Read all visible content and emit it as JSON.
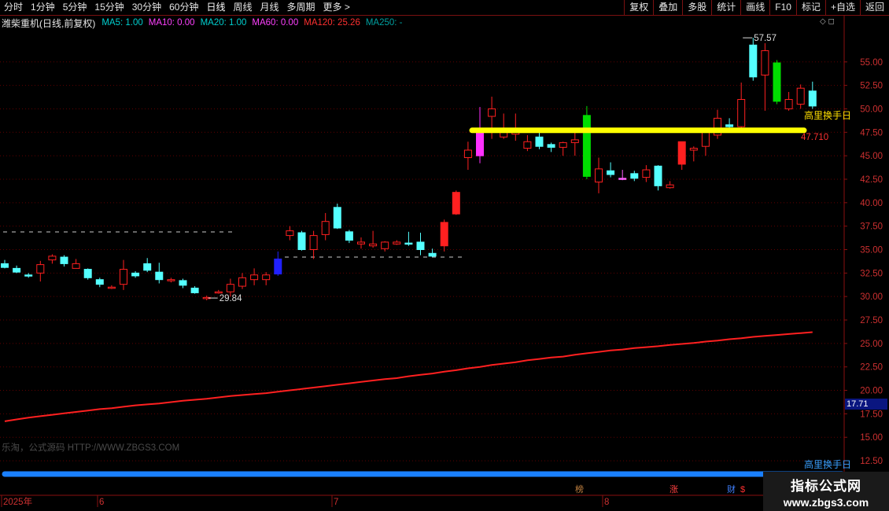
{
  "toolbar": {
    "periods": [
      "分时",
      "1分钟",
      "5分钟",
      "15分钟",
      "30分钟",
      "60分钟",
      "日线",
      "周线",
      "月线",
      "多周期",
      "更多 >"
    ],
    "active_period": "日线",
    "buttons": [
      "复权",
      "叠加",
      "多股",
      "统计",
      "画线",
      "F10",
      "标记",
      "+自选",
      "返回"
    ]
  },
  "info": {
    "stock": "潍柴重机(日线,前复权)",
    "ma": [
      {
        "label": "MA5: 1.00",
        "color": "#00d0d0"
      },
      {
        "label": "MA10: 0.00",
        "color": "#ff40ff"
      },
      {
        "label": "MA20: 1.00",
        "color": "#00d0d0"
      },
      {
        "label": "MA60: 0.00",
        "color": "#ff40ff"
      },
      {
        "label": "MA120: 25.26",
        "color": "#ff3030"
      },
      {
        "label": "MA250: -",
        "color": "#00a0a0"
      }
    ],
    "corner_icons": "◇ ◻"
  },
  "labels": {
    "high": "57.57",
    "low": "29.84",
    "line_value": "47.710",
    "yellow_name": "高里换手日",
    "blue_name": "高里换手日",
    "current_price": "17.71",
    "watermark": "乐淘，公式源码 HTTP://WWW.ZBGS3.COM",
    "logo_line1": "指标公式网",
    "logo_line2": "www.zbgs3.com"
  },
  "time_axis": [
    {
      "label": "2025年"
    },
    {
      "label": "6"
    },
    {
      "label": "7"
    },
    {
      "label": "8"
    }
  ],
  "event_markers": [
    {
      "label": "榜",
      "color": "#c08040"
    },
    {
      "label": "涨",
      "color": "#ff4040"
    },
    {
      "label": "财",
      "color": "#4080ff"
    },
    {
      "label": "$",
      "color": "#ff3030"
    }
  ],
  "colors": {
    "up": "#ff2020",
    "down": "#54ffff",
    "grid": "#600000",
    "ma120": "#ff2020",
    "yellow_line": "#ffff00",
    "blue_line": "#1a80ff"
  },
  "chart_data": {
    "type": "candlestick",
    "ylim": [
      11.5,
      58.5
    ],
    "y_ticks": [
      12.5,
      15.0,
      17.5,
      20.0,
      22.5,
      25.0,
      27.5,
      30.0,
      32.5,
      35.0,
      37.5,
      40.0,
      42.5,
      45.0,
      47.5,
      50.0,
      52.5,
      55.0
    ],
    "candles": [
      {
        "o": 33.5,
        "h": 33.9,
        "l": 33.0,
        "c": 33.1,
        "up": false
      },
      {
        "o": 33.0,
        "h": 33.3,
        "l": 32.5,
        "c": 32.6,
        "up": false
      },
      {
        "o": 32.3,
        "h": 32.5,
        "l": 32.0,
        "c": 32.3,
        "up": false
      },
      {
        "o": 32.5,
        "h": 33.8,
        "l": 31.6,
        "c": 33.4,
        "up": true
      },
      {
        "o": 33.9,
        "h": 34.5,
        "l": 33.5,
        "c": 34.3,
        "up": true
      },
      {
        "o": 34.2,
        "h": 34.4,
        "l": 33.2,
        "c": 33.5,
        "up": false
      },
      {
        "o": 33.5,
        "h": 34.0,
        "l": 33.0,
        "c": 33.0,
        "up": true
      },
      {
        "o": 32.9,
        "h": 33.0,
        "l": 31.8,
        "c": 32.0,
        "up": false
      },
      {
        "o": 31.8,
        "h": 32.0,
        "l": 31.0,
        "c": 31.3,
        "up": false
      },
      {
        "o": 30.9,
        "h": 31.2,
        "l": 30.8,
        "c": 31.0,
        "up": true
      },
      {
        "o": 31.3,
        "h": 33.9,
        "l": 30.7,
        "c": 32.9,
        "up": true
      },
      {
        "o": 32.5,
        "h": 32.7,
        "l": 32.0,
        "c": 32.2,
        "up": false
      },
      {
        "o": 33.5,
        "h": 34.1,
        "l": 32.6,
        "c": 32.8,
        "up": false
      },
      {
        "o": 32.6,
        "h": 33.6,
        "l": 31.4,
        "c": 31.8,
        "up": false
      },
      {
        "o": 31.8,
        "h": 32.0,
        "l": 31.5,
        "c": 31.7,
        "up": true
      },
      {
        "o": 31.7,
        "h": 31.9,
        "l": 30.9,
        "c": 31.2,
        "up": false
      },
      {
        "o": 30.9,
        "h": 31.1,
        "l": 30.3,
        "c": 30.4,
        "up": false
      },
      {
        "o": 29.9,
        "h": 30.1,
        "l": 29.6,
        "c": 29.9,
        "up": true
      },
      {
        "o": 30.4,
        "h": 30.7,
        "l": 30.3,
        "c": 30.5,
        "up": true
      },
      {
        "o": 30.5,
        "h": 31.9,
        "l": 30.0,
        "c": 31.3,
        "up": true
      },
      {
        "o": 31.1,
        "h": 32.5,
        "l": 30.8,
        "c": 32.0,
        "up": true
      },
      {
        "o": 31.8,
        "h": 33.0,
        "l": 31.2,
        "c": 32.3,
        "up": true
      },
      {
        "o": 31.8,
        "h": 32.6,
        "l": 31.2,
        "c": 32.3,
        "up": true
      },
      {
        "o": 32.4,
        "h": 34.8,
        "l": 32.2,
        "c": 34.0,
        "up": false,
        "color": "#2020ff"
      },
      {
        "o": 36.5,
        "h": 37.5,
        "l": 36.0,
        "c": 37.0,
        "up": true
      },
      {
        "o": 36.8,
        "h": 37.0,
        "l": 34.9,
        "c": 35.0,
        "up": false
      },
      {
        "o": 35.0,
        "h": 37.0,
        "l": 34.0,
        "c": 36.5,
        "up": true
      },
      {
        "o": 36.6,
        "h": 38.9,
        "l": 36.0,
        "c": 38.0,
        "up": true
      },
      {
        "o": 39.5,
        "h": 39.9,
        "l": 37.2,
        "c": 37.3,
        "up": false
      },
      {
        "o": 36.9,
        "h": 37.1,
        "l": 35.7,
        "c": 36.0,
        "up": false
      },
      {
        "o": 35.6,
        "h": 36.3,
        "l": 35.1,
        "c": 35.8,
        "up": true
      },
      {
        "o": 35.6,
        "h": 37.0,
        "l": 35.2,
        "c": 35.4,
        "up": true
      },
      {
        "o": 35.1,
        "h": 35.9,
        "l": 34.8,
        "c": 35.8,
        "up": true
      },
      {
        "o": 35.8,
        "h": 36.0,
        "l": 35.5,
        "c": 35.6,
        "up": true
      },
      {
        "o": 35.7,
        "h": 36.9,
        "l": 35.4,
        "c": 35.6,
        "up": false
      },
      {
        "o": 35.8,
        "h": 36.8,
        "l": 34.4,
        "c": 35.0,
        "up": false
      },
      {
        "o": 34.6,
        "h": 35.1,
        "l": 34.2,
        "c": 34.3,
        "up": false
      },
      {
        "o": 35.4,
        "h": 38.2,
        "l": 34.8,
        "c": 37.9,
        "up": true,
        "fill": true
      },
      {
        "o": 38.8,
        "h": 41.3,
        "l": 38.7,
        "c": 41.1,
        "up": true,
        "fill": true
      },
      {
        "o": 44.8,
        "h": 46.5,
        "l": 43.5,
        "c": 45.6,
        "up": true
      },
      {
        "o": 45.0,
        "h": 50.2,
        "l": 44.2,
        "c": 47.8,
        "up": true,
        "fill": true,
        "color": "#ff30ff"
      },
      {
        "o": 49.2,
        "h": 51.3,
        "l": 46.8,
        "c": 50.0,
        "up": true
      },
      {
        "o": 47.5,
        "h": 49.5,
        "l": 46.8,
        "c": 47.0,
        "up": true
      },
      {
        "o": 47.3,
        "h": 49.5,
        "l": 46.6,
        "c": 47.6,
        "up": true
      },
      {
        "o": 46.5,
        "h": 47.2,
        "l": 45.5,
        "c": 45.8,
        "up": true
      },
      {
        "o": 47.0,
        "h": 47.5,
        "l": 45.7,
        "c": 46.0,
        "up": false
      },
      {
        "o": 46.2,
        "h": 46.4,
        "l": 45.4,
        "c": 45.9,
        "up": false
      },
      {
        "o": 45.9,
        "h": 46.5,
        "l": 45.0,
        "c": 46.4,
        "up": true
      },
      {
        "o": 46.4,
        "h": 47.9,
        "l": 45.0,
        "c": 46.7,
        "up": true
      },
      {
        "o": 49.3,
        "h": 50.3,
        "l": 42.5,
        "c": 42.8,
        "up": false,
        "fill": true,
        "color": "#00dd00"
      },
      {
        "o": 42.2,
        "h": 44.8,
        "l": 41.0,
        "c": 43.6,
        "up": true
      },
      {
        "o": 43.0,
        "h": 44.3,
        "l": 42.7,
        "c": 43.4,
        "up": false
      },
      {
        "o": 42.6,
        "h": 43.5,
        "l": 42.4,
        "c": 42.5,
        "up": true,
        "color": "#ff60ff"
      },
      {
        "o": 42.6,
        "h": 43.4,
        "l": 42.3,
        "c": 43.1,
        "up": false
      },
      {
        "o": 42.7,
        "h": 44.0,
        "l": 42.2,
        "c": 43.5,
        "up": true
      },
      {
        "o": 43.9,
        "h": 44.0,
        "l": 41.3,
        "c": 41.8,
        "up": false
      },
      {
        "o": 41.6,
        "h": 42.3,
        "l": 41.5,
        "c": 41.9,
        "up": true
      },
      {
        "o": 44.1,
        "h": 46.5,
        "l": 43.5,
        "c": 46.5,
        "up": true,
        "fill": true
      },
      {
        "o": 45.6,
        "h": 46.0,
        "l": 44.4,
        "c": 45.8,
        "up": true
      },
      {
        "o": 46.0,
        "h": 48.0,
        "l": 45.0,
        "c": 47.5,
        "up": true
      },
      {
        "o": 47.2,
        "h": 49.9,
        "l": 46.8,
        "c": 49.0,
        "up": true
      },
      {
        "o": 48.1,
        "h": 49.0,
        "l": 47.6,
        "c": 48.3,
        "up": false
      },
      {
        "o": 48.1,
        "h": 52.8,
        "l": 47.5,
        "c": 51.0,
        "up": true
      },
      {
        "o": 56.8,
        "h": 57.57,
        "l": 53.0,
        "c": 53.4,
        "up": false,
        "fill": true
      },
      {
        "o": 53.6,
        "h": 57.0,
        "l": 49.8,
        "c": 56.2,
        "up": true
      },
      {
        "o": 54.9,
        "h": 55.2,
        "l": 50.5,
        "c": 50.8,
        "up": false,
        "fill": true,
        "color": "#00dd00"
      },
      {
        "o": 50.0,
        "h": 51.8,
        "l": 49.8,
        "c": 51.0,
        "up": true
      },
      {
        "o": 50.5,
        "h": 52.6,
        "l": 50.0,
        "c": 52.2,
        "up": true
      },
      {
        "o": 51.9,
        "h": 52.9,
        "l": 50.0,
        "c": 50.3,
        "up": false
      }
    ],
    "ma120": [
      16.7,
      16.9,
      17.1,
      17.25,
      17.4,
      17.55,
      17.7,
      17.85,
      18.0,
      18.1,
      18.25,
      18.4,
      18.5,
      18.6,
      18.75,
      18.9,
      19.0,
      19.1,
      19.25,
      19.4,
      19.5,
      19.6,
      19.7,
      19.85,
      20.0,
      20.15,
      20.3,
      20.45,
      20.6,
      20.75,
      20.9,
      21.05,
      21.2,
      21.3,
      21.5,
      21.65,
      21.8,
      22.0,
      22.15,
      22.35,
      22.5,
      22.7,
      22.85,
      23.0,
      23.2,
      23.35,
      23.5,
      23.6,
      23.8,
      23.95,
      24.1,
      24.25,
      24.35,
      24.5,
      24.6,
      24.7,
      24.85,
      24.95,
      25.05,
      25.2,
      25.3,
      25.45,
      25.55,
      25.7,
      25.8,
      25.9,
      26.0,
      26.1,
      26.2
    ]
  }
}
